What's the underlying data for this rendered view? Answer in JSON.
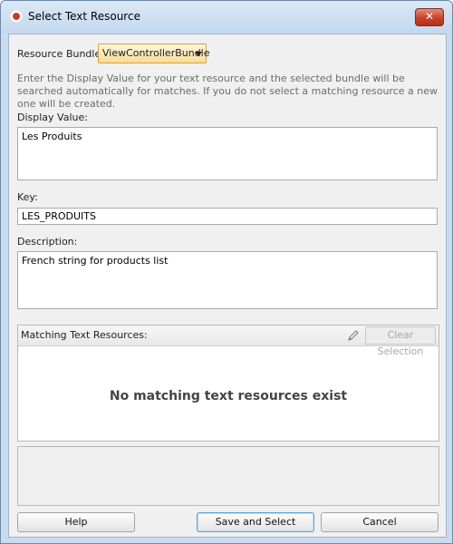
{
  "window": {
    "title": "Select Text Resource",
    "close_label": "✕"
  },
  "resource_bundle": {
    "label": "Resource Bundle:",
    "selected": "ViewControllerBundle"
  },
  "instructions": "Enter the Display Value for your text resource and the selected bundle will be searched automatically for matches.  If you do not select a matching resource a new one will be created.",
  "display_value": {
    "label": "Display Value:",
    "value": "Les Produits"
  },
  "key": {
    "label": "Key:",
    "value": "LES_PRODUITS"
  },
  "description": {
    "label": "Description:",
    "value": "French string for products list"
  },
  "matching": {
    "label": "Matching Text Resources:",
    "clear_label": "Clear Selection",
    "empty_message": "No matching text resources exist"
  },
  "buttons": {
    "help": "Help",
    "save": "Save and Select",
    "cancel": "Cancel"
  },
  "icons": {
    "app": "oracle-logo-icon",
    "edit": "pencil-icon",
    "dropdown": "chevron-down-icon",
    "close": "close-icon"
  }
}
